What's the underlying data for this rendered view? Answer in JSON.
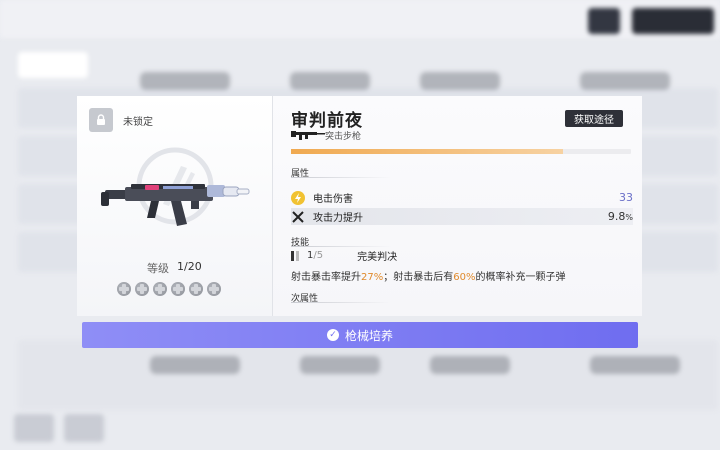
{
  "weapon": {
    "name": "审判前夜",
    "type_label": "突击步枪",
    "source_button": "获取途径",
    "lock_label": "未锁定",
    "level_label": "等级",
    "level_value": "1/20",
    "slot_icon": "plus-dot-icon",
    "experience_fraction": 0.8,
    "colors": {
      "accent_purple": "#6f6df0",
      "progress_orange": "#f0a950",
      "highlight_orange": "#e08a2c",
      "attack_value": "#6a6fc8"
    }
  },
  "attributes": {
    "title": "属性",
    "items": [
      {
        "name": "电击伤害",
        "value": "33",
        "icon": "lightning-icon"
      },
      {
        "name": "攻击力提升",
        "value": "9.8",
        "unit": "%",
        "icon": "crossed-swords-icon"
      }
    ]
  },
  "skill": {
    "title": "技能",
    "level": "1",
    "max": "/5",
    "name": "完美判决",
    "desc_part1": "射击暴击率提升",
    "desc_value1": "27%",
    "desc_part2": "；射击暴击后有",
    "desc_value2": "60%",
    "desc_part3": "的概率补充一颗子弹"
  },
  "sub_attributes": {
    "title": "次属性"
  },
  "cta": {
    "label": "枪械培养",
    "icon": "check-circle-icon"
  }
}
